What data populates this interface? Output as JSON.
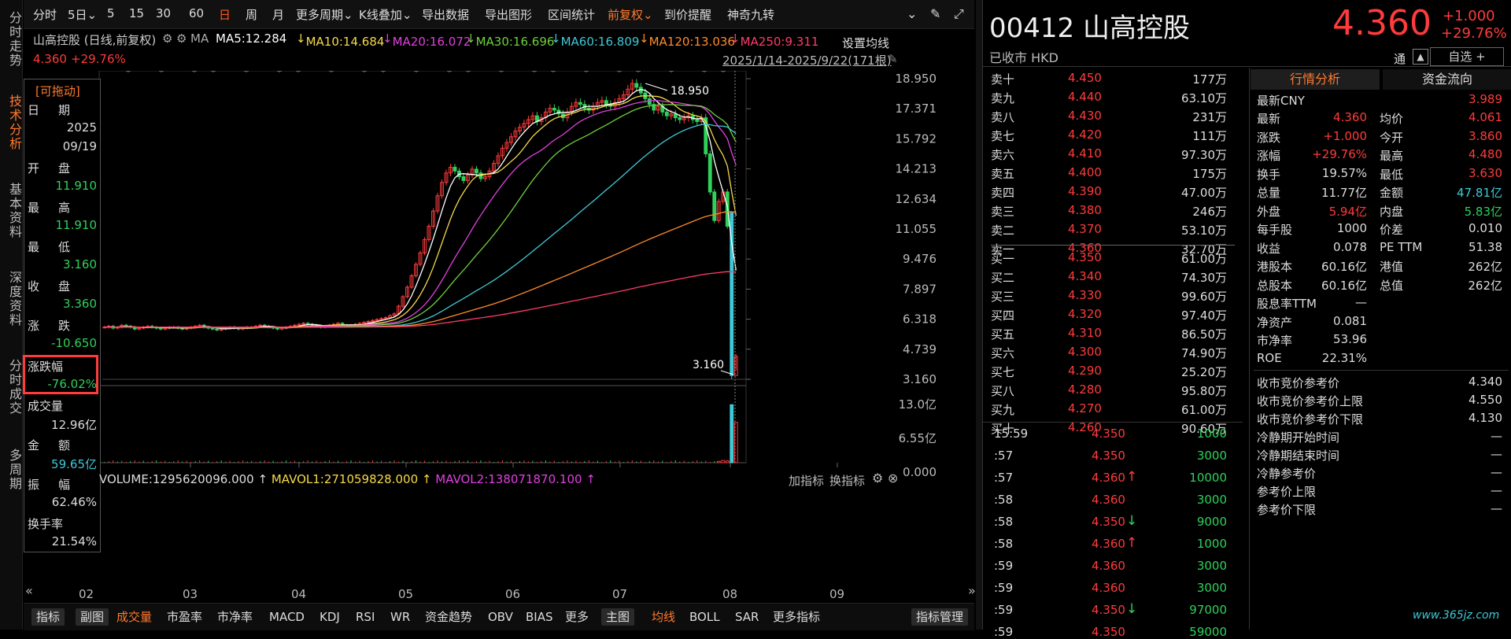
{
  "left_tabs": [
    "分时走势",
    "技术分析",
    "基本资料",
    "深度资料",
    "分时成交",
    "多周期"
  ],
  "toolbar": {
    "items": [
      "分时",
      "5日",
      "5",
      "15",
      "30",
      "60",
      "日",
      "周",
      "月",
      "更多周期",
      "K线叠加",
      "导出数据",
      "导出图形",
      "区间统计",
      "前复权",
      "到价提醒",
      "神奇九转"
    ]
  },
  "ma_bar": {
    "name": "山高控股 (日线,前复权)",
    "ma_label": "MA",
    "ma5": "MA5:12.284",
    "ma10": "MA10:14.684",
    "ma20": "MA20:16.072",
    "ma30": "MA30:16.696",
    "ma60": "MA60:16.809",
    "ma120": "MA120:13.036",
    "ma250": "MA250:9.311",
    "settings": "设置均线",
    "colors": {
      "ma5": "#ffffff",
      "ma10": "#f5d94a",
      "ma20": "#e040e0",
      "ma30": "#6fd13b",
      "ma60": "#3fc9d6",
      "ma120": "#ff8c2b",
      "ma250": "#ff3b6b"
    }
  },
  "price_strip": {
    "price": "4.360",
    "pct": "+29.76%",
    "range": "2025/1/14-2025/9/22(171根)"
  },
  "info_box": {
    "drag": "[可拖动]",
    "date_l": "日",
    "date_r": "期",
    "year": "2025",
    "md": "09/19",
    "open_l": "开",
    "open_r": "盘",
    "open": "11.910",
    "high_l": "最",
    "high_r": "高",
    "high": "11.910",
    "low_l": "最",
    "low_r": "低",
    "low": "3.160",
    "close_l": "收",
    "close_r": "盘",
    "close": "3.360",
    "chg_l": "涨",
    "chg_r": "跌",
    "chg": "-10.650",
    "pct_l": "涨跌幅",
    "pct": "-76.02%",
    "vol_l": "成交量",
    "vol": "12.96亿",
    "amt_l": "金",
    "amt_r": "额",
    "amt": "59.65亿",
    "amp_l": "振",
    "amp_r": "幅",
    "amp": "62.46%",
    "turn_l": "换手率",
    "turn": "21.54%"
  },
  "chart_data": {
    "type": "candlestick",
    "y_ticks": [
      "18.950",
      "17.371",
      "15.792",
      "14.213",
      "12.634",
      "11.055",
      "9.476",
      "7.897",
      "6.318",
      "4.739",
      "3.160"
    ],
    "ylim": [
      3.16,
      18.95
    ],
    "x_ticks": [
      "02",
      "03",
      "04",
      "05",
      "06",
      "07",
      "08",
      "09"
    ],
    "high_label": "18.950",
    "low_label": "3.160",
    "closes": [
      5.9,
      5.95,
      5.85,
      5.9,
      6.0,
      5.95,
      5.9,
      5.8,
      5.85,
      5.9,
      5.95,
      5.9,
      5.85,
      5.8,
      5.85,
      5.9,
      5.9,
      5.85,
      5.8,
      5.85,
      5.9,
      5.95,
      6.0,
      5.9,
      5.85,
      5.8,
      5.75,
      5.8,
      5.85,
      5.9,
      5.85,
      5.8,
      5.85,
      5.9,
      5.9,
      5.95,
      6.0,
      5.95,
      5.9,
      5.85,
      5.8,
      5.85,
      5.9,
      5.95,
      6.0,
      6.05,
      6.1,
      6.05,
      6.0,
      5.95,
      5.9,
      5.95,
      6.0,
      6.05,
      6.1,
      6.0,
      5.95,
      6.0,
      6.05,
      6.1,
      6.15,
      6.2,
      6.25,
      6.3,
      6.35,
      6.4,
      6.5,
      6.6,
      7.0,
      7.5,
      8.0,
      8.6,
      9.2,
      9.8,
      10.5,
      11.2,
      12.0,
      12.8,
      13.5,
      14.0,
      14.3,
      14.1,
      13.8,
      13.6,
      13.9,
      14.2,
      14.0,
      13.7,
      13.8,
      14.1,
      14.5,
      14.9,
      15.3,
      15.6,
      15.9,
      16.2,
      16.4,
      16.6,
      16.8,
      17.0,
      16.7,
      16.9,
      17.2,
      17.4,
      17.3,
      17.1,
      16.9,
      17.2,
      17.5,
      17.7,
      17.6,
      17.4,
      17.3,
      17.5,
      17.7,
      17.8,
      17.6,
      17.5,
      17.7,
      17.9,
      18.1,
      18.4,
      18.7,
      18.5,
      18.2,
      17.9,
      17.6,
      17.3,
      17.5,
      17.2,
      17.0,
      17.1,
      16.9,
      16.8,
      16.9,
      17.0,
      16.8,
      16.7,
      16.9,
      15.0,
      13.0,
      11.5,
      12.5,
      13.0,
      11.2,
      3.36,
      4.36
    ],
    "volume": {
      "label": "VOLUME:1295620096.000",
      "mavol1": "MAVOL1:271059828.000",
      "mavol2": "MAVOL2:138071870.100",
      "y_ticks": [
        "13.0亿",
        "6.55亿",
        "0.000"
      ],
      "last_bars": [
        0.3,
        0.5,
        0.4,
        12.96,
        9.0
      ]
    },
    "vol_actions": [
      "加指标",
      "换指标"
    ]
  },
  "bottom_bar": {
    "left": [
      "指标",
      "副图",
      "成交量",
      "市盈率",
      "市净率",
      "MACD",
      "KDJ",
      "RSI",
      "WR",
      "资金趋势",
      "OBV",
      "BIAS",
      "更多"
    ],
    "right": [
      "主图",
      "均线",
      "BOLL",
      "SAR",
      "更多指标"
    ],
    "manage": "指标管理"
  },
  "quote": {
    "code": "00412",
    "name": "山高控股",
    "price": "4.360",
    "chg": "+1.000",
    "pct": "+29.76%",
    "status": "已收市 HKD",
    "tong": "通",
    "zixuan": "自选",
    "asks": [
      [
        "卖十",
        "4.450",
        "177万"
      ],
      [
        "卖九",
        "4.440",
        "63.10万"
      ],
      [
        "卖八",
        "4.430",
        "231万"
      ],
      [
        "卖七",
        "4.420",
        "111万"
      ],
      [
        "卖六",
        "4.410",
        "97.30万"
      ],
      [
        "卖五",
        "4.400",
        "175万"
      ],
      [
        "卖四",
        "4.390",
        "47.00万"
      ],
      [
        "卖三",
        "4.380",
        "246万"
      ],
      [
        "卖二",
        "4.370",
        "53.10万"
      ],
      [
        "卖一",
        "4.360",
        "32.70万"
      ]
    ],
    "bids": [
      [
        "买一",
        "4.350",
        "61.00万"
      ],
      [
        "买二",
        "4.340",
        "74.30万"
      ],
      [
        "买三",
        "4.330",
        "99.60万"
      ],
      [
        "买四",
        "4.320",
        "97.40万"
      ],
      [
        "买五",
        "4.310",
        "86.50万"
      ],
      [
        "买六",
        "4.300",
        "74.90万"
      ],
      [
        "买七",
        "4.290",
        "25.20万"
      ],
      [
        "买八",
        "4.280",
        "95.80万"
      ],
      [
        "买九",
        "4.270",
        "61.00万"
      ],
      [
        "买十",
        "4.260",
        "90.60万"
      ]
    ],
    "ticks": [
      [
        "15:59",
        "4.350",
        "",
        "1000"
      ],
      [
        ":57",
        "4.350",
        "",
        "3000"
      ],
      [
        ":57",
        "4.360",
        "up",
        "10000"
      ],
      [
        ":58",
        "4.360",
        "",
        "3000"
      ],
      [
        ":58",
        "4.350",
        "down",
        "9000"
      ],
      [
        ":58",
        "4.360",
        "up",
        "1000"
      ],
      [
        ":59",
        "4.360",
        "",
        "3000"
      ],
      [
        ":59",
        "4.360",
        "",
        "3000"
      ],
      [
        ":59",
        "4.350",
        "down",
        "97000"
      ],
      [
        ":59",
        "4.350",
        "",
        "59000"
      ]
    ],
    "tab_active": "行情分析",
    "tab_other": "资金流向",
    "cny_l": "最新CNY",
    "cny": "3.989",
    "stats": [
      [
        "最新",
        "4.360",
        "red",
        "均价",
        "4.061",
        "red"
      ],
      [
        "涨跌",
        "+1.000",
        "red",
        "今开",
        "3.860",
        "red"
      ],
      [
        "涨幅",
        "+29.76%",
        "red",
        "最高",
        "4.480",
        "red"
      ],
      [
        "换手",
        "19.57%",
        "white",
        "最低",
        "3.630",
        "red"
      ],
      [
        "总量",
        "11.77亿",
        "white",
        "金额",
        "47.81亿",
        "cyan"
      ],
      [
        "外盘",
        "5.94亿",
        "red",
        "内盘",
        "5.83亿",
        "green"
      ],
      [
        "每手股",
        "1000",
        "white",
        "价差",
        "0.010",
        "white"
      ],
      [
        "收益",
        "0.078",
        "white",
        "PE TTM",
        "51.38",
        "white"
      ],
      [
        "港股本",
        "60.16亿",
        "white",
        "港值",
        "262亿",
        "white"
      ],
      [
        "总股本",
        "60.16亿",
        "white",
        "总值",
        "262亿",
        "white"
      ],
      [
        "股息率TTM",
        "—",
        "white",
        "",
        "",
        " white"
      ],
      [
        "净资产",
        "0.081",
        "white",
        "",
        "",
        ""
      ],
      [
        "市净率",
        "53.96",
        "white",
        "",
        "",
        ""
      ],
      [
        "ROE",
        "22.31%",
        "white",
        "",
        "",
        ""
      ]
    ],
    "auction": [
      [
        "收市竞价参考价",
        "4.340"
      ],
      [
        "收市竞价参考价上限",
        "4.550"
      ],
      [
        "收市竞价参考价下限",
        "4.130"
      ],
      [
        "冷静期开始时间",
        "—"
      ],
      [
        "冷静期结束时间",
        "—"
      ],
      [
        "冷静参考价",
        "—"
      ],
      [
        "参考价上限",
        "—"
      ],
      [
        "参考价下限",
        "—"
      ]
    ],
    "watermark": "www.365jz.com"
  }
}
